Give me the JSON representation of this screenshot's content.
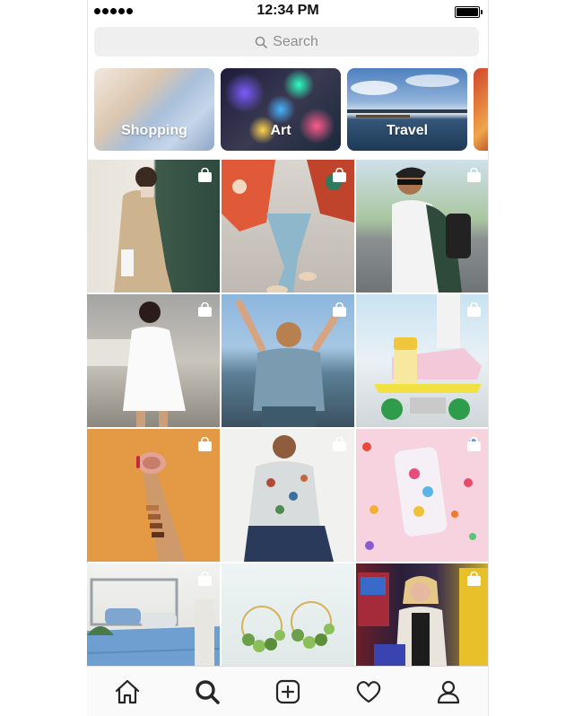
{
  "status_bar": {
    "time": "12:34 PM"
  },
  "search": {
    "placeholder": "Search"
  },
  "categories": [
    {
      "label": "Shopping"
    },
    {
      "label": "Art"
    },
    {
      "label": "Travel"
    },
    {
      "label": ""
    }
  ],
  "grid": [
    {
      "subject": "woman in trench coat",
      "shoppable": true
    },
    {
      "subject": "floral outfit and sneakers",
      "shoppable": true
    },
    {
      "subject": "man with backpack",
      "shoppable": true
    },
    {
      "subject": "woman in white dress",
      "shoppable": true
    },
    {
      "subject": "woman dancing by lake",
      "shoppable": true
    },
    {
      "subject": "sneakers on skateboard",
      "shoppable": true
    },
    {
      "subject": "hand with compact and swatches",
      "shoppable": true
    },
    {
      "subject": "man in floral shirt",
      "shoppable": true
    },
    {
      "subject": "candy phone case",
      "shoppable": true
    },
    {
      "subject": "blue bedding",
      "shoppable": true
    },
    {
      "subject": "green earrings",
      "shoppable": false
    },
    {
      "subject": "woman in arcade",
      "shoppable": true
    }
  ],
  "tab_bar": {
    "items": [
      {
        "icon": "home-icon"
      },
      {
        "icon": "search-icon",
        "active": true
      },
      {
        "icon": "add-icon"
      },
      {
        "icon": "heart-icon"
      },
      {
        "icon": "profile-icon"
      }
    ]
  },
  "colors": {
    "search_bg": "#efefef",
    "placeholder": "#8e8e8e",
    "tab_bar_bg": "#fafafa"
  }
}
